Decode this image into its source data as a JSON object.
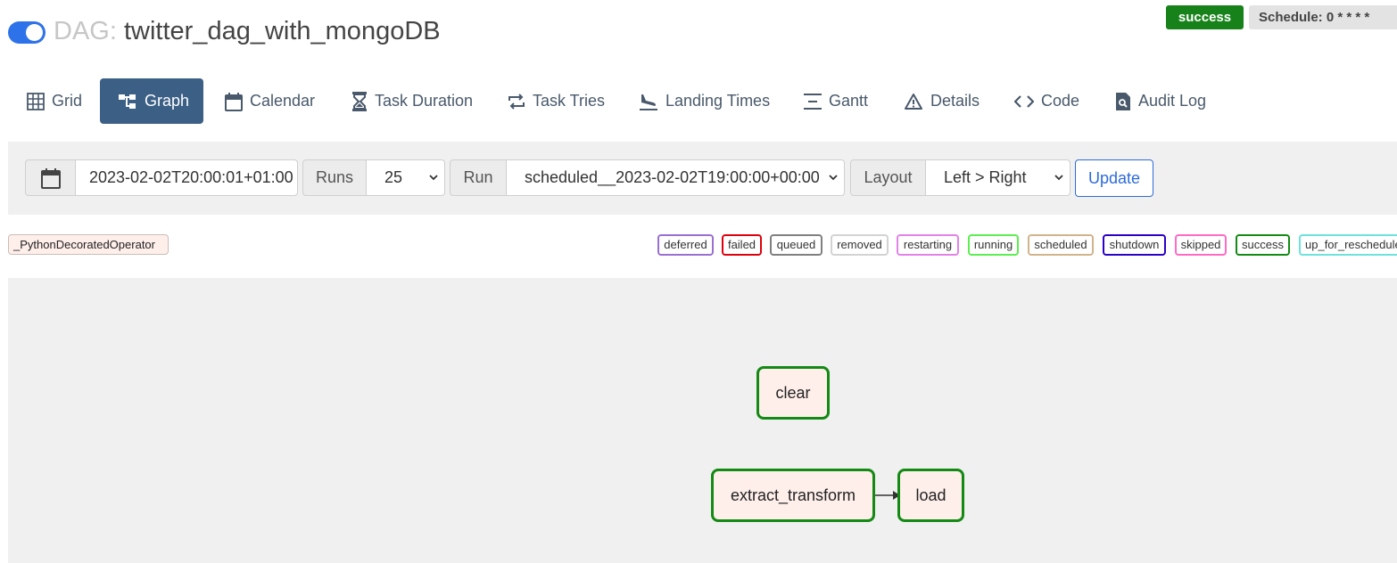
{
  "header": {
    "prefix": "DAG:",
    "dag_id": "twitter_dag_with_mongoDB",
    "status": "success",
    "schedule": "Schedule: 0 * * * *",
    "status_color": "#17821a"
  },
  "tabs": [
    {
      "label": "Grid",
      "icon": "grid-icon"
    },
    {
      "label": "Graph",
      "icon": "graph-icon",
      "active": true
    },
    {
      "label": "Calendar",
      "icon": "calendar-icon"
    },
    {
      "label": "Task Duration",
      "icon": "hourglass-icon"
    },
    {
      "label": "Task Tries",
      "icon": "retry-icon"
    },
    {
      "label": "Landing Times",
      "icon": "plane-landing-icon"
    },
    {
      "label": "Gantt",
      "icon": "gantt-icon"
    },
    {
      "label": "Details",
      "icon": "warning-icon"
    },
    {
      "label": "Code",
      "icon": "code-icon"
    },
    {
      "label": "Audit Log",
      "icon": "file-search-icon"
    }
  ],
  "controls": {
    "base_date": "2023-02-02T20:00:01+01:00",
    "runs_label": "Runs",
    "runs_value": "25",
    "run_label": "Run",
    "run_value": "scheduled__2023-02-02T19:00:00+00:00",
    "layout_label": "Layout",
    "layout_value": "Left > Right",
    "update_label": "Update"
  },
  "legend": {
    "operator": "_PythonDecoratedOperator",
    "operator_color": "#ffefeb",
    "states": [
      {
        "label": "deferred",
        "color": "#9a6fd1"
      },
      {
        "label": "failed",
        "color": "#e0000c"
      },
      {
        "label": "queued",
        "color": "#808080"
      },
      {
        "label": "removed",
        "color": "#d3d3d3"
      },
      {
        "label": "restarting",
        "color": "#e382e9"
      },
      {
        "label": "running",
        "color": "#5dee51"
      },
      {
        "label": "scheduled",
        "color": "#d2b48c"
      },
      {
        "label": "shutdown",
        "color": "#2b00c9"
      },
      {
        "label": "skipped",
        "color": "#ff6bc4"
      },
      {
        "label": "success",
        "color": "#138a14"
      },
      {
        "label": "up_for_reschedule",
        "color": "#6de2de"
      }
    ]
  },
  "graph": {
    "nodes": [
      {
        "id": "clear",
        "label": "clear"
      },
      {
        "id": "extract_transform",
        "label": "extract_transform"
      },
      {
        "id": "load",
        "label": "load"
      }
    ],
    "edges": [
      {
        "from": "extract_transform",
        "to": "load"
      }
    ]
  }
}
